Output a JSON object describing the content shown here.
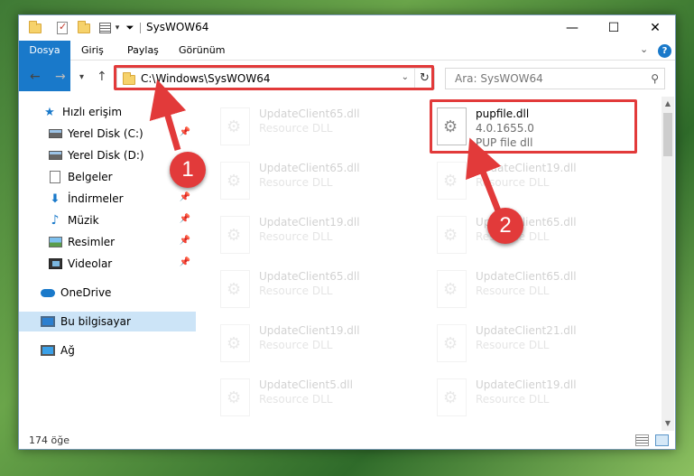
{
  "window": {
    "title": "SysWOW64",
    "quick_access_dropdown": "▾",
    "controls": {
      "minimize": "—",
      "maximize": "☐",
      "close": "✕"
    }
  },
  "ribbon": {
    "tabs": [
      "Dosya",
      "Giriş",
      "Paylaş",
      "Görünüm"
    ],
    "expand_icon": "⌄",
    "help_icon": "?"
  },
  "nav": {
    "back": "←",
    "forward": "→",
    "recent": "▾",
    "up": "↑",
    "address": "C:\\Windows\\SysWOW64",
    "address_dropdown": "⌄",
    "refresh": "↻",
    "search_placeholder": "Ara: SysWOW64",
    "search_icon": "⚲"
  },
  "sidebar": {
    "items": [
      {
        "label": "Hızlı erişim",
        "icon": "star-icon",
        "pinned": false
      },
      {
        "label": "Yerel Disk (C:)",
        "icon": "drive-icon",
        "pinned": true
      },
      {
        "label": "Yerel Disk (D:)",
        "icon": "drive-icon",
        "pinned": false
      },
      {
        "label": "Belgeler",
        "icon": "documents-icon",
        "pinned": false
      },
      {
        "label": "İndirmeler",
        "icon": "downloads-icon",
        "pinned": true
      },
      {
        "label": "Müzik",
        "icon": "music-icon",
        "pinned": true
      },
      {
        "label": "Resimler",
        "icon": "pictures-icon",
        "pinned": true
      },
      {
        "label": "Videolar",
        "icon": "videos-icon",
        "pinned": true
      },
      {
        "label": "OneDrive",
        "icon": "onedrive-icon",
        "pinned": false
      },
      {
        "label": "Bu bilgisayar",
        "icon": "this-pc-icon",
        "pinned": false,
        "selected": true
      },
      {
        "label": "Ağ",
        "icon": "network-icon",
        "pinned": false
      }
    ],
    "pin_glyph": "📌"
  },
  "files": [
    {
      "name": "UpdateClient65.dll",
      "line1": "Resource DLL",
      "line2": ""
    },
    {
      "name": "pupfile.dll",
      "line1": "4.0.1655.0",
      "line2": "PUP file dll",
      "highlighted": true
    },
    {
      "name": "UpdateClient65.dll",
      "line1": "Resource DLL",
      "line2": ""
    },
    {
      "name": "UpdateClient19.dll",
      "line1": "Resource DLL",
      "line2": ""
    },
    {
      "name": "UpdateClient19.dll",
      "line1": "Resource DLL",
      "line2": ""
    },
    {
      "name": "UpdateClient65.dll",
      "line1": "Resource DLL",
      "line2": ""
    },
    {
      "name": "UpdateClient65.dll",
      "line1": "Resource DLL",
      "line2": ""
    },
    {
      "name": "UpdateClient65.dll",
      "line1": "Resource DLL",
      "line2": ""
    },
    {
      "name": "UpdateClient19.dll",
      "line1": "Resource DLL",
      "line2": ""
    },
    {
      "name": "UpdateClient21.dll",
      "line1": "Resource DLL",
      "line2": ""
    },
    {
      "name": "UpdateClient5.dll",
      "line1": "Resource DLL",
      "line2": ""
    },
    {
      "name": "UpdateClient19.dll",
      "line1": "Resource DLL",
      "line2": ""
    }
  ],
  "status": {
    "item_count": "174 öğe"
  },
  "annotations": {
    "marker1": "1",
    "marker2": "2",
    "color": "#e23a3a"
  },
  "colors": {
    "accent": "#1979ca",
    "selection": "#cce4f7"
  }
}
